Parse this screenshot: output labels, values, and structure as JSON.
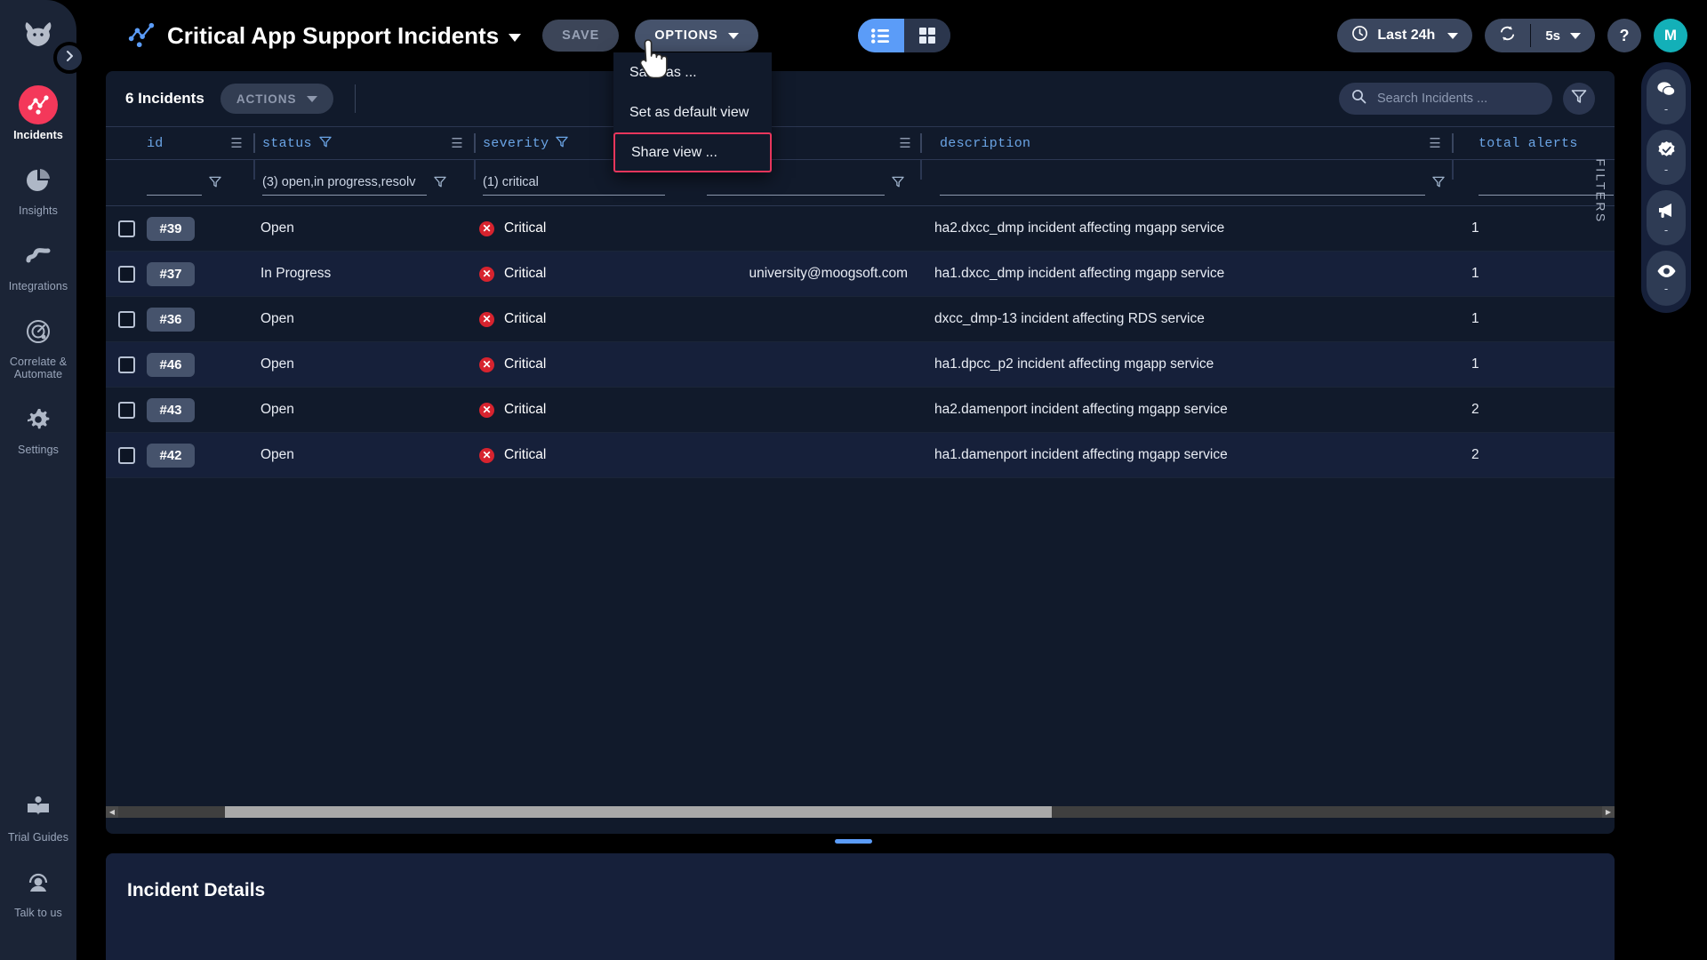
{
  "brand": {
    "logo_icon": "moose-head-logo"
  },
  "sidebar": {
    "expand_icon": "chevron-right-icon",
    "items": [
      {
        "label": "Incidents",
        "icon": "incidents-icon",
        "active": true
      },
      {
        "label": "Insights",
        "icon": "pie-chart-icon",
        "active": false
      },
      {
        "label": "Integrations",
        "icon": "integrations-icon",
        "active": false
      },
      {
        "label": "Correlate & Automate",
        "icon": "radar-icon",
        "active": false
      },
      {
        "label": "Settings",
        "icon": "gear-icon",
        "active": false
      }
    ],
    "bottom_items": [
      {
        "label": "Trial Guides",
        "icon": "book-icon"
      },
      {
        "label": "Talk to us",
        "icon": "headset-icon"
      }
    ]
  },
  "header": {
    "view_logo_icon": "incidents-logo-icon",
    "title": "Critical App Support Incidents",
    "title_caret_icon": "caret-down-icon",
    "save_label": "SAVE",
    "options_label": "OPTIONS",
    "options_caret_icon": "caret-down-icon",
    "view_list_icon": "list-view-icon",
    "view_grid_icon": "grid-view-icon",
    "active_view": "list",
    "time_range": "Last 24h",
    "time_icon": "clock-icon",
    "refresh_icon": "refresh-icon",
    "refresh_interval": "5s",
    "help_label": "?",
    "avatar_initial": "M"
  },
  "options_menu": {
    "items": [
      {
        "label": "Save as ...",
        "highlighted": false
      },
      {
        "label": "Set as default view",
        "highlighted": false
      },
      {
        "label": "Share view ...",
        "highlighted": true
      }
    ]
  },
  "toolbar": {
    "count_text": "6 Incidents",
    "actions_label": "ACTIONS",
    "actions_caret_icon": "caret-down-icon",
    "search_placeholder": "Search Incidents ...",
    "search_value": "",
    "search_icon": "search-icon",
    "filter_icon": "funnel-icon"
  },
  "table": {
    "columns": [
      {
        "key": "id",
        "label": "id",
        "filter_icon": null,
        "grip_icon": "grip-icon"
      },
      {
        "key": "status",
        "label": "status",
        "filter_icon": "funnel-icon",
        "grip_icon": "grip-icon"
      },
      {
        "key": "severity",
        "label": "severity",
        "filter_icon": "funnel-icon",
        "grip_icon": "grip-icon"
      },
      {
        "key": "owner",
        "label": "",
        "filter_icon": null,
        "grip_icon": "grip-icon"
      },
      {
        "key": "description",
        "label": "description",
        "filter_icon": null,
        "grip_icon": "grip-icon"
      },
      {
        "key": "total_alerts",
        "label": "total alerts",
        "filter_icon": null,
        "grip_icon": null
      }
    ],
    "filters": {
      "id": "",
      "status": "(3) open,in progress,resolv",
      "severity": "(1) critical",
      "owner": "",
      "description": "",
      "total_alerts": ""
    },
    "rows": [
      {
        "id": "#39",
        "status": "Open",
        "severity": "Critical",
        "severity_icon": "critical-icon",
        "owner": "",
        "description": "ha2.dxcc_dmp incident affecting mgapp service",
        "total_alerts": "1"
      },
      {
        "id": "#37",
        "status": "In Progress",
        "severity": "Critical",
        "severity_icon": "critical-icon",
        "owner": "university@moogsoft.com",
        "description": "ha1.dxcc_dmp incident affecting mgapp service",
        "total_alerts": "1"
      },
      {
        "id": "#36",
        "status": "Open",
        "severity": "Critical",
        "severity_icon": "critical-icon",
        "owner": "",
        "description": "dxcc_dmp-13 incident affecting RDS service",
        "total_alerts": "1"
      },
      {
        "id": "#46",
        "status": "Open",
        "severity": "Critical",
        "severity_icon": "critical-icon",
        "owner": "",
        "description": "ha1.dpcc_p2 incident affecting mgapp service",
        "total_alerts": "1"
      },
      {
        "id": "#43",
        "status": "Open",
        "severity": "Critical",
        "severity_icon": "critical-icon",
        "owner": "",
        "description": "ha2.damenport incident affecting mgapp service",
        "total_alerts": "2"
      },
      {
        "id": "#42",
        "status": "Open",
        "severity": "Critical",
        "severity_icon": "critical-icon",
        "owner": "",
        "description": "ha1.damenport incident affecting mgapp service",
        "total_alerts": "2"
      }
    ]
  },
  "right_rail": {
    "filters_label": "FILTERS",
    "buttons": [
      {
        "icon": "comments-icon",
        "count": "-"
      },
      {
        "icon": "verified-icon",
        "count": "-"
      },
      {
        "icon": "megaphone-icon",
        "count": "-"
      },
      {
        "icon": "eye-icon",
        "count": "-"
      }
    ]
  },
  "details": {
    "title": "Incident Details"
  },
  "colors": {
    "accent_blue": "#5b9cf8",
    "brand_pink": "#f4385a",
    "critical_red": "#d7232e",
    "avatar_teal": "#13b0b8",
    "highlight_border": "#e8365c",
    "header_text_blue": "#6ba5e6"
  }
}
